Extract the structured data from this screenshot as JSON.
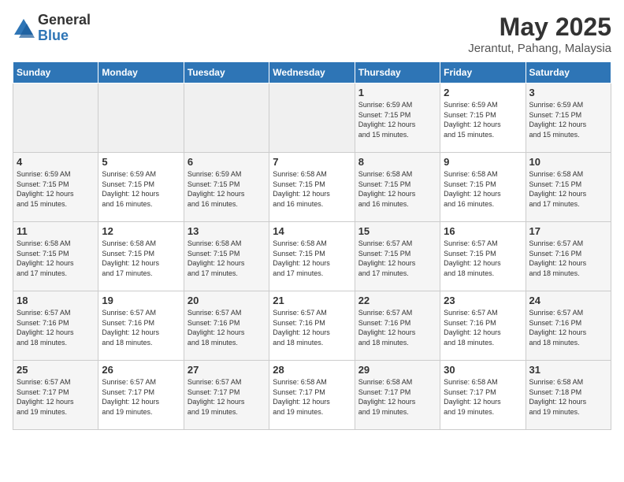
{
  "logo": {
    "general": "General",
    "blue": "Blue"
  },
  "title": "May 2025",
  "subtitle": "Jerantut, Pahang, Malaysia",
  "days_of_week": [
    "Sunday",
    "Monday",
    "Tuesday",
    "Wednesday",
    "Thursday",
    "Friday",
    "Saturday"
  ],
  "weeks": [
    [
      {
        "day": "",
        "info": ""
      },
      {
        "day": "",
        "info": ""
      },
      {
        "day": "",
        "info": ""
      },
      {
        "day": "",
        "info": ""
      },
      {
        "day": "1",
        "info": "Sunrise: 6:59 AM\nSunset: 7:15 PM\nDaylight: 12 hours\nand 15 minutes."
      },
      {
        "day": "2",
        "info": "Sunrise: 6:59 AM\nSunset: 7:15 PM\nDaylight: 12 hours\nand 15 minutes."
      },
      {
        "day": "3",
        "info": "Sunrise: 6:59 AM\nSunset: 7:15 PM\nDaylight: 12 hours\nand 15 minutes."
      }
    ],
    [
      {
        "day": "4",
        "info": "Sunrise: 6:59 AM\nSunset: 7:15 PM\nDaylight: 12 hours\nand 15 minutes."
      },
      {
        "day": "5",
        "info": "Sunrise: 6:59 AM\nSunset: 7:15 PM\nDaylight: 12 hours\nand 16 minutes."
      },
      {
        "day": "6",
        "info": "Sunrise: 6:59 AM\nSunset: 7:15 PM\nDaylight: 12 hours\nand 16 minutes."
      },
      {
        "day": "7",
        "info": "Sunrise: 6:58 AM\nSunset: 7:15 PM\nDaylight: 12 hours\nand 16 minutes."
      },
      {
        "day": "8",
        "info": "Sunrise: 6:58 AM\nSunset: 7:15 PM\nDaylight: 12 hours\nand 16 minutes."
      },
      {
        "day": "9",
        "info": "Sunrise: 6:58 AM\nSunset: 7:15 PM\nDaylight: 12 hours\nand 16 minutes."
      },
      {
        "day": "10",
        "info": "Sunrise: 6:58 AM\nSunset: 7:15 PM\nDaylight: 12 hours\nand 17 minutes."
      }
    ],
    [
      {
        "day": "11",
        "info": "Sunrise: 6:58 AM\nSunset: 7:15 PM\nDaylight: 12 hours\nand 17 minutes."
      },
      {
        "day": "12",
        "info": "Sunrise: 6:58 AM\nSunset: 7:15 PM\nDaylight: 12 hours\nand 17 minutes."
      },
      {
        "day": "13",
        "info": "Sunrise: 6:58 AM\nSunset: 7:15 PM\nDaylight: 12 hours\nand 17 minutes."
      },
      {
        "day": "14",
        "info": "Sunrise: 6:58 AM\nSunset: 7:15 PM\nDaylight: 12 hours\nand 17 minutes."
      },
      {
        "day": "15",
        "info": "Sunrise: 6:57 AM\nSunset: 7:15 PM\nDaylight: 12 hours\nand 17 minutes."
      },
      {
        "day": "16",
        "info": "Sunrise: 6:57 AM\nSunset: 7:15 PM\nDaylight: 12 hours\nand 18 minutes."
      },
      {
        "day": "17",
        "info": "Sunrise: 6:57 AM\nSunset: 7:16 PM\nDaylight: 12 hours\nand 18 minutes."
      }
    ],
    [
      {
        "day": "18",
        "info": "Sunrise: 6:57 AM\nSunset: 7:16 PM\nDaylight: 12 hours\nand 18 minutes."
      },
      {
        "day": "19",
        "info": "Sunrise: 6:57 AM\nSunset: 7:16 PM\nDaylight: 12 hours\nand 18 minutes."
      },
      {
        "day": "20",
        "info": "Sunrise: 6:57 AM\nSunset: 7:16 PM\nDaylight: 12 hours\nand 18 minutes."
      },
      {
        "day": "21",
        "info": "Sunrise: 6:57 AM\nSunset: 7:16 PM\nDaylight: 12 hours\nand 18 minutes."
      },
      {
        "day": "22",
        "info": "Sunrise: 6:57 AM\nSunset: 7:16 PM\nDaylight: 12 hours\nand 18 minutes."
      },
      {
        "day": "23",
        "info": "Sunrise: 6:57 AM\nSunset: 7:16 PM\nDaylight: 12 hours\nand 18 minutes."
      },
      {
        "day": "24",
        "info": "Sunrise: 6:57 AM\nSunset: 7:16 PM\nDaylight: 12 hours\nand 18 minutes."
      }
    ],
    [
      {
        "day": "25",
        "info": "Sunrise: 6:57 AM\nSunset: 7:17 PM\nDaylight: 12 hours\nand 19 minutes."
      },
      {
        "day": "26",
        "info": "Sunrise: 6:57 AM\nSunset: 7:17 PM\nDaylight: 12 hours\nand 19 minutes."
      },
      {
        "day": "27",
        "info": "Sunrise: 6:57 AM\nSunset: 7:17 PM\nDaylight: 12 hours\nand 19 minutes."
      },
      {
        "day": "28",
        "info": "Sunrise: 6:58 AM\nSunset: 7:17 PM\nDaylight: 12 hours\nand 19 minutes."
      },
      {
        "day": "29",
        "info": "Sunrise: 6:58 AM\nSunset: 7:17 PM\nDaylight: 12 hours\nand 19 minutes."
      },
      {
        "day": "30",
        "info": "Sunrise: 6:58 AM\nSunset: 7:17 PM\nDaylight: 12 hours\nand 19 minutes."
      },
      {
        "day": "31",
        "info": "Sunrise: 6:58 AM\nSunset: 7:18 PM\nDaylight: 12 hours\nand 19 minutes."
      }
    ]
  ]
}
